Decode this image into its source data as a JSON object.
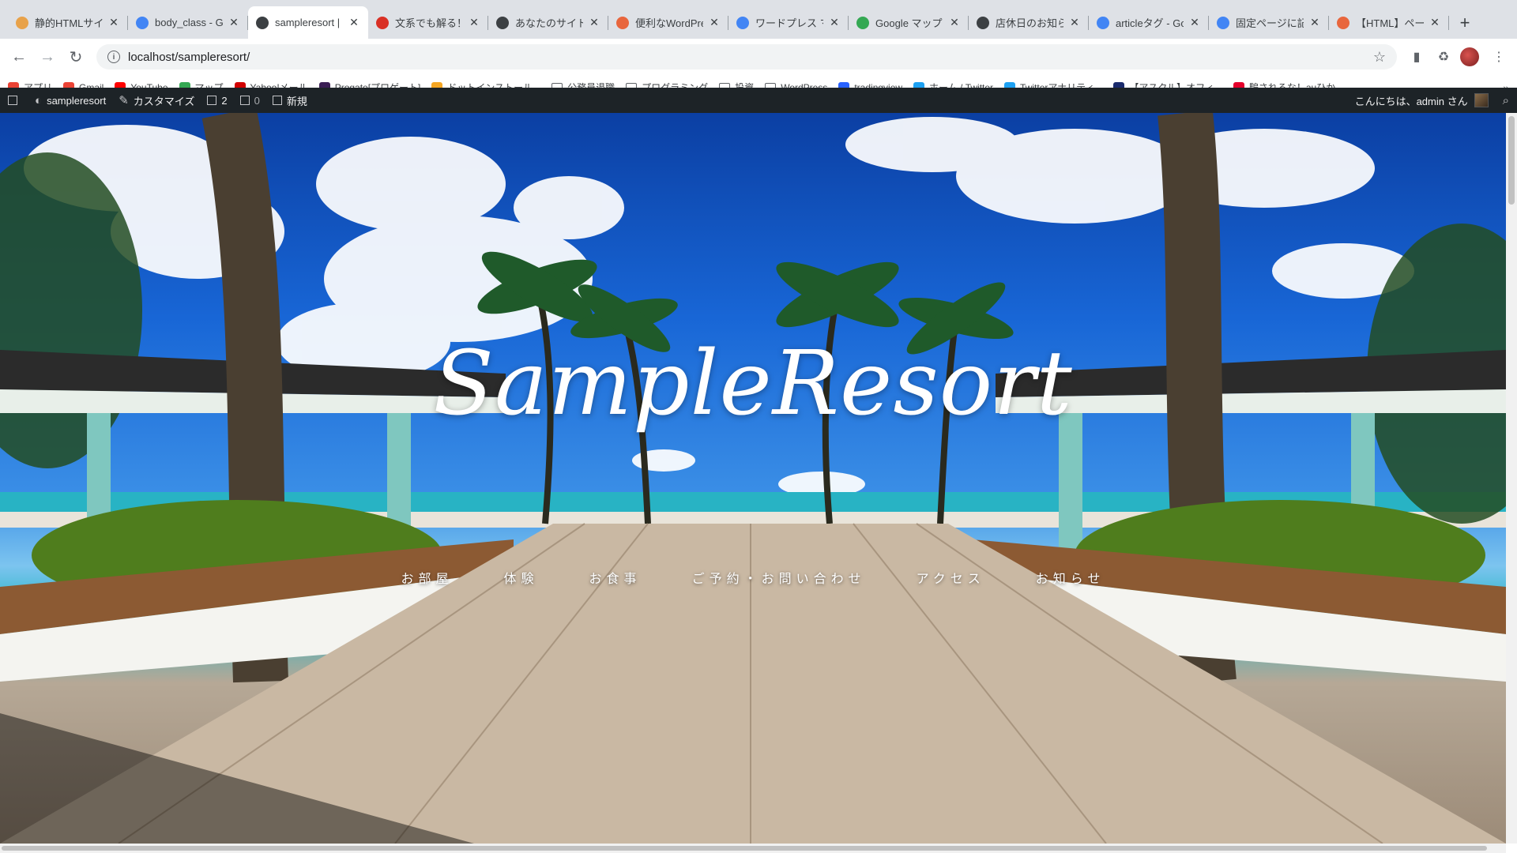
{
  "browser": {
    "tabs": [
      {
        "title": "静的HTMLサイト",
        "icon": "claw-icon",
        "color": "#e8a24a",
        "active": false
      },
      {
        "title": "body_class - Go",
        "icon": "google-icon",
        "color": "#4285f4",
        "active": false
      },
      {
        "title": "sampleresort |",
        "icon": "wordpress-icon",
        "color": "#3c4043",
        "active": true
      },
      {
        "title": "文系でも解る！W",
        "icon": "bookmark-icon",
        "color": "#d93025",
        "active": false
      },
      {
        "title": "あなたのサイトを",
        "icon": "globe-icon",
        "color": "#3c4043",
        "active": false
      },
      {
        "title": "便利なWordPress",
        "icon": "square-logo-icon",
        "color": "#e8663d",
        "active": false
      },
      {
        "title": "ワードプレス マ",
        "icon": "google-icon",
        "color": "#4285f4",
        "active": false
      },
      {
        "title": "Google マップ",
        "icon": "maps-pin-icon",
        "color": "#34a853",
        "active": false
      },
      {
        "title": "店休日のお知らせ",
        "icon": "wordpress-icon",
        "color": "#3c4043",
        "active": false
      },
      {
        "title": "articleタグ - Go",
        "icon": "google-icon",
        "color": "#4285f4",
        "active": false
      },
      {
        "title": "固定ページに記事",
        "icon": "google-icon",
        "color": "#4285f4",
        "active": false
      },
      {
        "title": "【HTML】ページ",
        "icon": "square-logo-icon",
        "color": "#e8663d",
        "active": false
      }
    ],
    "new_tab_glyph": "+",
    "close_glyph": "✕",
    "url": "localhost/sampleresort/",
    "info_glyph": "i",
    "star_glyph": "☆",
    "back_glyph": "←",
    "forward_glyph": "→",
    "reload_glyph": "↻"
  },
  "bookmarks": [
    {
      "label": "アプリ",
      "icon": "apps-grid-icon"
    },
    {
      "label": "Gmail",
      "icon": "gmail-icon"
    },
    {
      "label": "YouTube",
      "icon": "youtube-icon"
    },
    {
      "label": "マップ",
      "icon": "maps-pin-icon"
    },
    {
      "label": "Yahoo!メール",
      "icon": "yahoo-icon"
    },
    {
      "label": "Progate[プロゲート]",
      "icon": "progate-icon"
    },
    {
      "label": "ドットインストール...",
      "icon": "dotinstall-icon"
    },
    {
      "label": "公務員退職",
      "icon": "folder-icon"
    },
    {
      "label": "プログラミング",
      "icon": "folder-icon"
    },
    {
      "label": "投資",
      "icon": "folder-icon"
    },
    {
      "label": "WordPress",
      "icon": "folder-icon"
    },
    {
      "label": "tradingview",
      "icon": "tradingview-icon"
    },
    {
      "label": "ホーム / Twitter",
      "icon": "twitter-icon"
    },
    {
      "label": "Twitterアナリティ...",
      "icon": "twitter-icon"
    },
    {
      "label": "【アスクル】オフィ...",
      "icon": "askul-icon"
    },
    {
      "label": "騙されるな！auひか...",
      "icon": "red-dot-icon"
    }
  ],
  "bookmarks_more_glyph": "»",
  "adminbar": {
    "site_name": "sampleresort",
    "customize": "カスタマイズ",
    "updates_count": "2",
    "comments_count": "0",
    "new_label": "新規",
    "greeting": "こんにちは、admin さん"
  },
  "hero": {
    "logo_text": "SampleResort",
    "nav": [
      "お部屋",
      "体験",
      "お食事",
      "ご予約・お問い合わせ",
      "アクセス",
      "お知らせ"
    ]
  }
}
